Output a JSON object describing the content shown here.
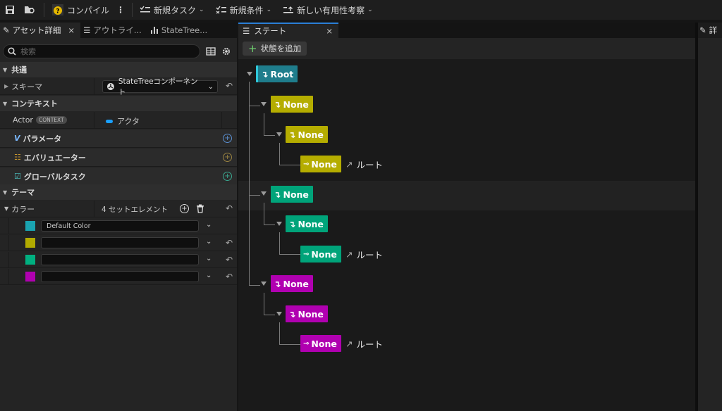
{
  "toolbar": {
    "compile": "コンパイル",
    "new_task": "新規タスク",
    "new_condition": "新規条件",
    "new_utility": "新しい有用性考察"
  },
  "left_tabs": [
    "アセット詳細",
    "アウトライ...",
    "StateTree..."
  ],
  "search_placeholder": "検索",
  "sections": {
    "common": "共通",
    "context": "コンテキスト",
    "theme": "テーマ"
  },
  "schema": {
    "label": "スキーマ",
    "value": "StateTreeコンポーネント"
  },
  "actor": {
    "label": "Actor",
    "badge": "CONTEXT",
    "value": "アクタ"
  },
  "parameters": "パラメータ",
  "evaluators": "エバリュエーター",
  "global_tasks": "グローバルタスク",
  "colors": {
    "label": "カラー",
    "count": "4 セットエレメント",
    "first_name": "Default Color",
    "swatches": [
      "#1aa3b0",
      "#b2ab00",
      "#00b080",
      "#b000b0"
    ]
  },
  "center_tab": "ステート",
  "add_state": "状態を追加",
  "tree": {
    "root": "Root",
    "node_label": "None",
    "link_label": "ルート",
    "colors": {
      "root": "#1f7d8c",
      "yellow": "#b5ad00",
      "green": "#00a47a",
      "magenta": "#b000b0"
    }
  },
  "right_tab": "詳"
}
